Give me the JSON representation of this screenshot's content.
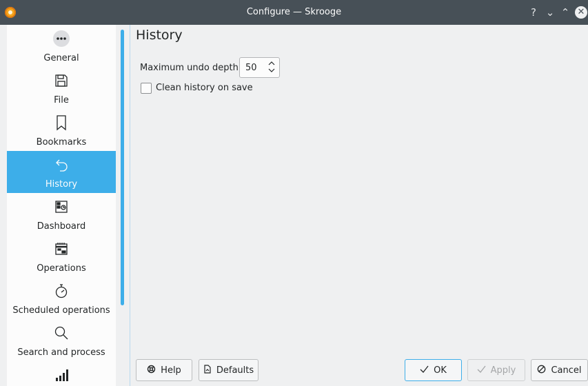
{
  "titlebar": {
    "title": "Configure — Skrooge",
    "help_glyph": "?",
    "minimize_glyph": "⌄",
    "maximize_glyph": "⌃",
    "close_glyph": "✕"
  },
  "sidebar": {
    "items": [
      {
        "label": "General",
        "icon": "more-dots-icon"
      },
      {
        "label": "File",
        "icon": "floppy-icon"
      },
      {
        "label": "Bookmarks",
        "icon": "bookmark-icon"
      },
      {
        "label": "History",
        "icon": "undo-arrow-icon",
        "active": true
      },
      {
        "label": "Dashboard",
        "icon": "dashboard-icon"
      },
      {
        "label": "Operations",
        "icon": "calendar-icon"
      },
      {
        "label": "Scheduled operations",
        "icon": "stopwatch-icon"
      },
      {
        "label": "Search and process",
        "icon": "search-icon"
      },
      {
        "label": "",
        "icon": "bar-chart-icon"
      }
    ]
  },
  "main": {
    "title": "History",
    "undo_depth_label": "Maximum undo depth:",
    "undo_depth_value": "50",
    "clean_history_label": "Clean history on save",
    "clean_history_checked": false
  },
  "buttons": {
    "help": "Help",
    "defaults": "Defaults",
    "ok": "OK",
    "apply": "Apply",
    "cancel": "Cancel"
  },
  "colors": {
    "accent": "#3daee9",
    "titlebar": "#475057",
    "window_bg": "#eff0f1"
  }
}
